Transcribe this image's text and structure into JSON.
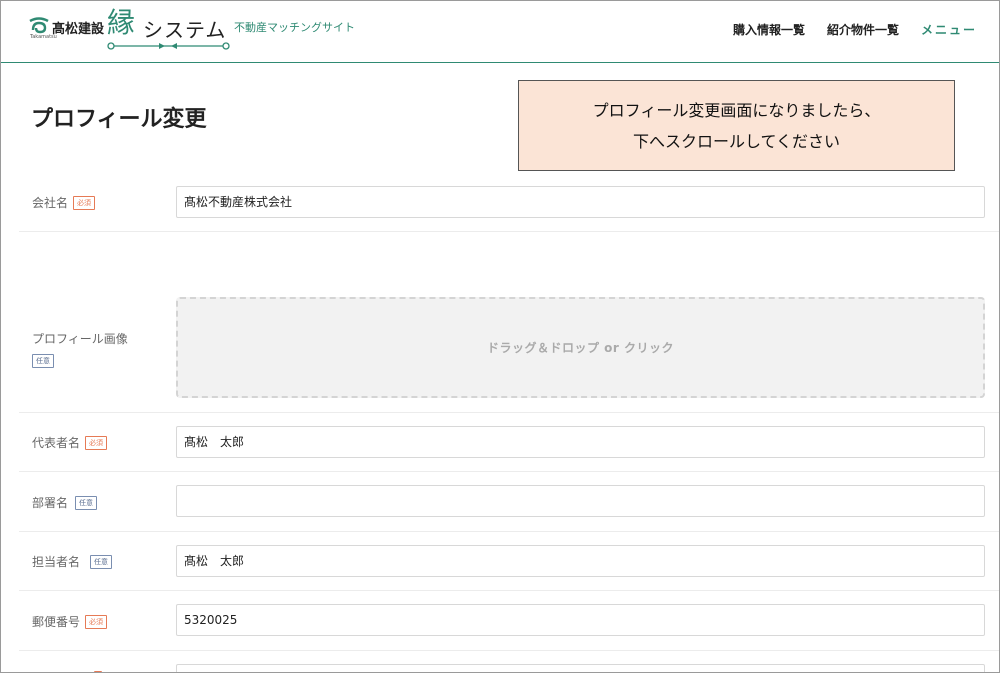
{
  "header": {
    "company": "髙松建設",
    "company_sub": "Takamatsu",
    "brand_kanji": "縁",
    "brand_text": "システム",
    "tagline": "不動産マッチングサイト",
    "nav": [
      "購入情報一覧",
      "紹介物件一覧",
      "メニュー"
    ]
  },
  "page": {
    "title": "プロフィール変更"
  },
  "callout": {
    "line1": "プロフィール変更画面になりましたら、",
    "line2": "下へスクロールしてください"
  },
  "form": {
    "required_badge": "必須",
    "optional_badge": "任意",
    "company_name": {
      "label": "会社名",
      "value": "髙松不動産株式会社"
    },
    "profile_image": {
      "label": "プロフィール画像",
      "dropzone_text": "ドラッグ＆ドロップ or クリック"
    },
    "representative": {
      "label": "代表者名",
      "value": "髙松　太郎"
    },
    "department": {
      "label": "部署名",
      "value": ""
    },
    "contact_person": {
      "label": "担当者名",
      "value": "髙松　太郎"
    },
    "postal_code": {
      "label": "郵便番号",
      "value": "5320025"
    }
  },
  "colors": {
    "accent": "#2f8a73",
    "callout_bg": "#fbe4d6",
    "required": "#e67a55",
    "optional": "#5a6e90"
  }
}
